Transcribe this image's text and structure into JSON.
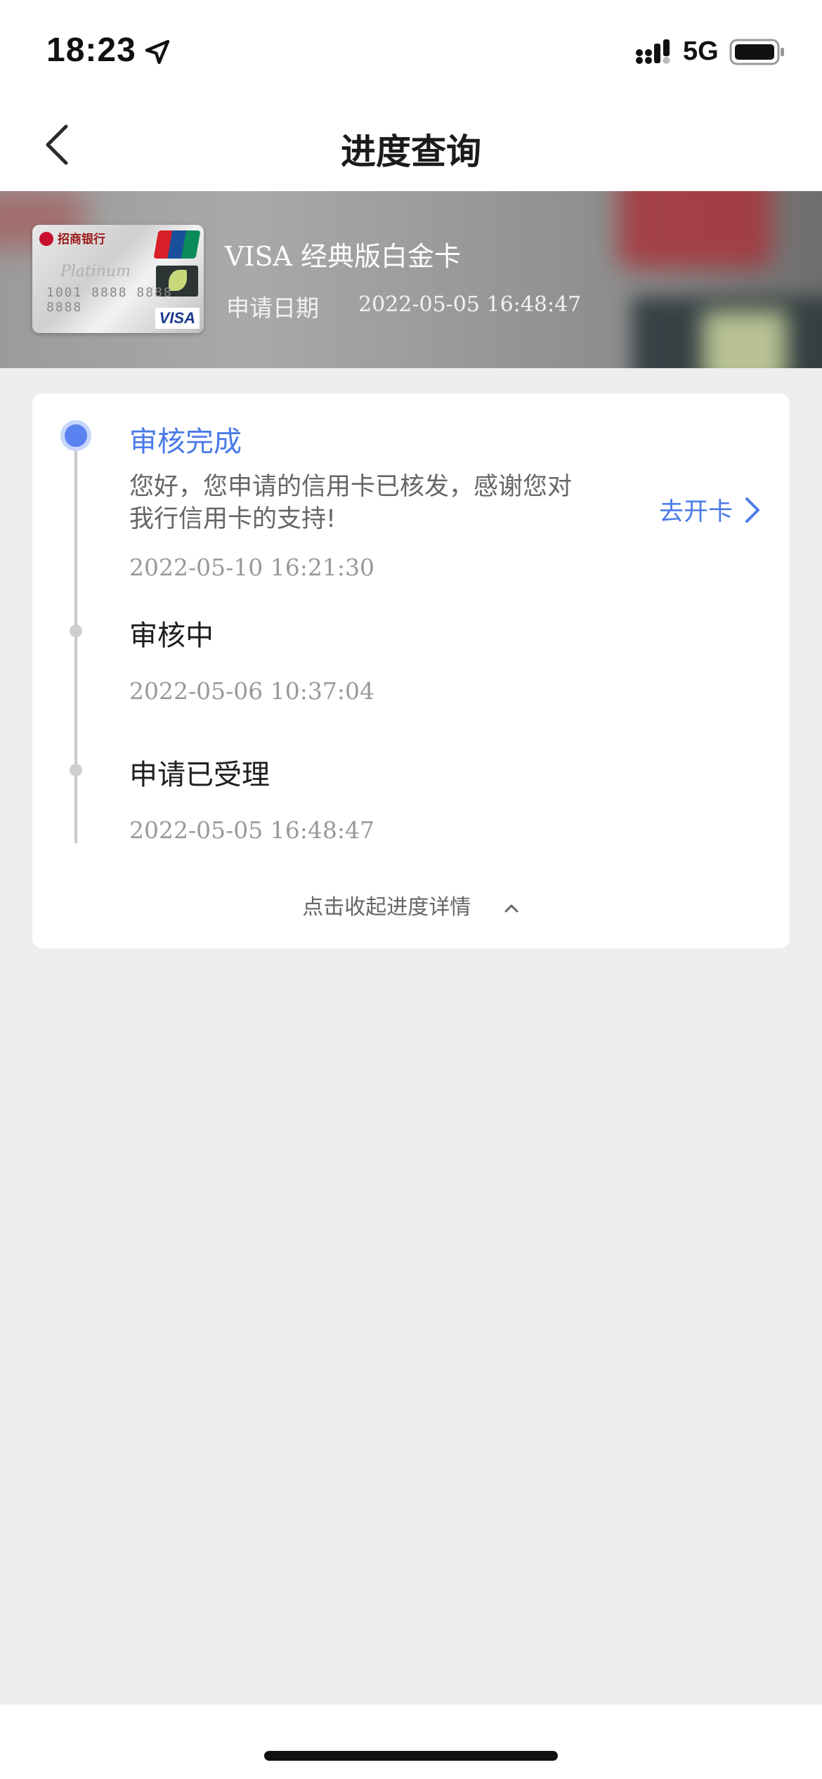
{
  "status_bar": {
    "time": "18:23",
    "network": "5G",
    "icons": [
      "location-arrow-icon",
      "signal-icon",
      "battery-icon"
    ]
  },
  "nav": {
    "title": "进度查询",
    "back_icon": "chevron-left-icon"
  },
  "card": {
    "name": "VISA 经典版白金卡",
    "apply_label": "申请日期",
    "apply_date": "2022-05-05 16:48:47",
    "thumb": {
      "bank": "招商银行",
      "number": "1001 8888 8888 8888",
      "brand": "VISA",
      "script": "Platinum"
    }
  },
  "timeline": {
    "steps": [
      {
        "title": "审核完成",
        "description": "您好，您申请的信用卡已核发，感谢您对我行信用卡的支持!",
        "time": "2022-05-10 16:21:30",
        "active": true,
        "action_label": "去开卡"
      },
      {
        "title": "审核中",
        "time": "2022-05-06 10:37:04",
        "active": false
      },
      {
        "title": "申请已受理",
        "time": "2022-05-05 16:48:47",
        "active": false
      }
    ],
    "collapse_label": "点击收起进度详情"
  },
  "colors": {
    "accent": "#4a7be8",
    "background": "#eeeeee",
    "dot_active": "#5a82f0"
  }
}
